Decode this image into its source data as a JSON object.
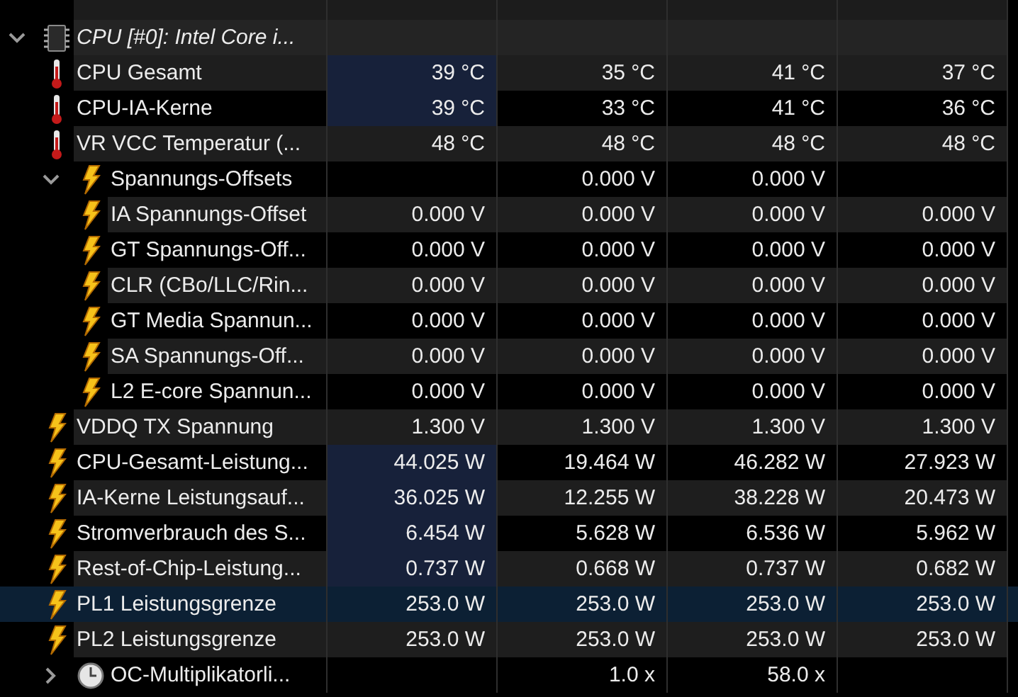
{
  "tree": [
    {
      "label": "CPU [#0]: Intel Core i...",
      "kind": "chip",
      "expanded": true,
      "selected": false,
      "highlighted": false,
      "children": [
        {
          "label": "CPU Gesamt",
          "kind": "thermometer",
          "selected": false,
          "highlighted": true,
          "col_1": "39 °C",
          "col_2": "35 °C",
          "col_3": "41 °C",
          "col_4": "37 °C"
        },
        {
          "label": "CPU-IA-Kerne",
          "kind": "thermometer",
          "selected": false,
          "highlighted": true,
          "col_1": "39 °C",
          "col_2": "33 °C",
          "col_3": "41 °C",
          "col_4": "36 °C"
        },
        {
          "label": "VR VCC Temperatur (...",
          "kind": "thermometer",
          "selected": false,
          "highlighted": false,
          "col_1": "48 °C",
          "col_2": "48 °C",
          "col_3": "48 °C",
          "col_4": "48 °C"
        },
        {
          "label": "Spannungs-Offsets",
          "kind": "bolt",
          "expanded": true,
          "selected": false,
          "highlighted": false,
          "col_2": "0.000 V",
          "col_3": "0.000 V",
          "children": [
            {
              "label": "IA Spannungs-Offset",
              "kind": "bolt",
              "selected": false,
              "highlighted": false,
              "col_1": "0.000 V",
              "col_2": "0.000 V",
              "col_3": "0.000 V",
              "col_4": "0.000 V"
            },
            {
              "label": "GT Spannungs-Off...",
              "kind": "bolt",
              "selected": false,
              "highlighted": false,
              "col_1": "0.000 V",
              "col_2": "0.000 V",
              "col_3": "0.000 V",
              "col_4": "0.000 V"
            },
            {
              "label": "CLR (CBo/LLC/Rin...",
              "kind": "bolt",
              "selected": false,
              "highlighted": false,
              "col_1": "0.000 V",
              "col_2": "0.000 V",
              "col_3": "0.000 V",
              "col_4": "0.000 V"
            },
            {
              "label": "GT Media Spannun...",
              "kind": "bolt",
              "selected": false,
              "highlighted": false,
              "col_1": "0.000 V",
              "col_2": "0.000 V",
              "col_3": "0.000 V",
              "col_4": "0.000 V"
            },
            {
              "label": "SA Spannungs-Off...",
              "kind": "bolt",
              "selected": false,
              "highlighted": false,
              "col_1": "0.000 V",
              "col_2": "0.000 V",
              "col_3": "0.000 V",
              "col_4": "0.000 V"
            },
            {
              "label": "L2 E-core Spannun...",
              "kind": "bolt",
              "selected": false,
              "highlighted": false,
              "col_1": "0.000 V",
              "col_2": "0.000 V",
              "col_3": "0.000 V",
              "col_4": "0.000 V"
            }
          ]
        },
        {
          "label": "VDDQ TX Spannung",
          "kind": "bolt",
          "selected": false,
          "highlighted": false,
          "col_1": "1.300 V",
          "col_2": "1.300 V",
          "col_3": "1.300 V",
          "col_4": "1.300 V"
        },
        {
          "label": "CPU-Gesamt-Leistung...",
          "kind": "bolt",
          "selected": false,
          "highlighted": true,
          "col_1": "44.025 W",
          "col_2": "19.464 W",
          "col_3": "46.282 W",
          "col_4": "27.923 W"
        },
        {
          "label": "IA-Kerne Leistungsauf...",
          "kind": "bolt",
          "selected": false,
          "highlighted": true,
          "col_1": "36.025 W",
          "col_2": "12.255 W",
          "col_3": "38.228 W",
          "col_4": "20.473 W"
        },
        {
          "label": "Stromverbrauch des S...",
          "kind": "bolt",
          "selected": false,
          "highlighted": true,
          "col_1": "6.454 W",
          "col_2": "5.628 W",
          "col_3": "6.536 W",
          "col_4": "5.962 W"
        },
        {
          "label": "Rest-of-Chip-Leistung...",
          "kind": "bolt",
          "selected": false,
          "highlighted": true,
          "col_1": "0.737 W",
          "col_2": "0.668 W",
          "col_3": "0.737 W",
          "col_4": "0.682 W"
        },
        {
          "label": "PL1 Leistungsgrenze",
          "kind": "bolt",
          "selected": true,
          "highlighted": false,
          "col_1": "253.0 W",
          "col_2": "253.0 W",
          "col_3": "253.0 W",
          "col_4": "253.0 W"
        },
        {
          "label": "PL2 Leistungsgrenze",
          "kind": "bolt",
          "selected": false,
          "highlighted": false,
          "col_1": "253.0 W",
          "col_2": "253.0 W",
          "col_3": "253.0 W",
          "col_4": "253.0 W"
        },
        {
          "label": "OC-Multiplikatorli...",
          "kind": "clock",
          "expanded": false,
          "selected": false,
          "highlighted": false,
          "col_2": "1.0 x",
          "col_3": "58.0 x"
        }
      ]
    }
  ]
}
